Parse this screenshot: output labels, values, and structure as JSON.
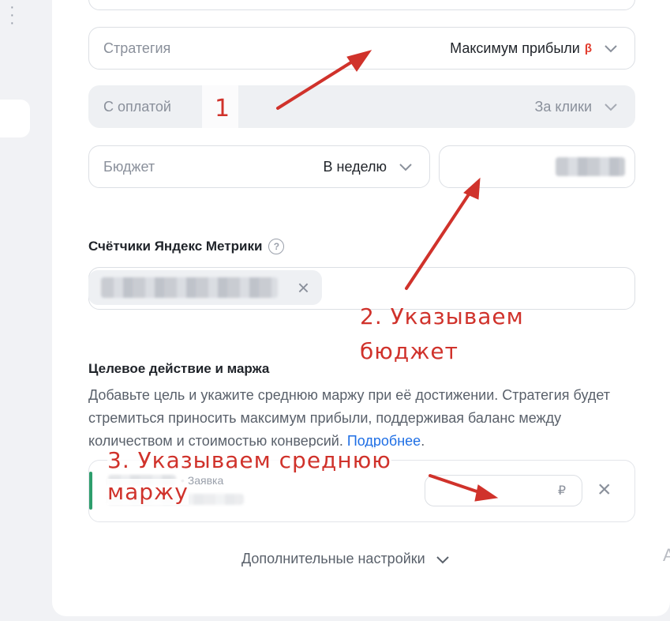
{
  "strategy": {
    "label": "Стратегия",
    "value": "Максимум прибыли",
    "badge": "β"
  },
  "payment": {
    "label": "С оплатой",
    "value": "За клики"
  },
  "budget": {
    "label": "Бюджет",
    "period": "В неделю"
  },
  "metrika": {
    "title": "Счётчики Яндекс Метрики"
  },
  "goal": {
    "title": "Целевое действие и маржа",
    "description": "Добавьте цель и укажите среднюю маржу при её достижении. Стратегия будет стремиться приносить максимум прибыли, поддерживая баланс между количеством и стоимостью конверсий.",
    "link": "Подробнее",
    "link_suffix": ".",
    "goal_type": "• Заявка",
    "currency": "₽"
  },
  "more_settings": "Дополнительные настройки",
  "annotations": {
    "one": "1",
    "two_line1": "2. Указываем",
    "two_line2": "бюджет",
    "three_line1": "3. Указываем среднюю",
    "three_line2": "маржу"
  },
  "colors": {
    "annotation": "#d0322b",
    "link": "#1f6fe5",
    "goal_bar": "#2e9e6d"
  }
}
